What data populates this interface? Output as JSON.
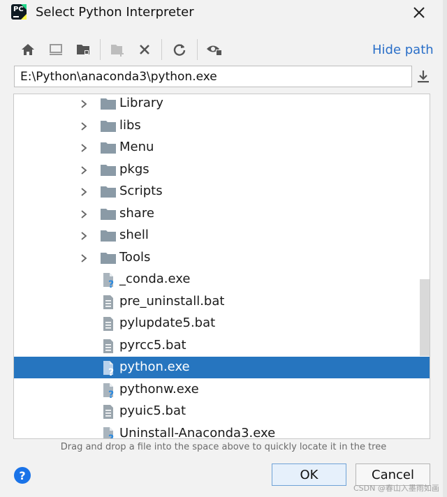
{
  "window": {
    "title": "Select Python Interpreter"
  },
  "toolbar": {
    "icons": [
      "home-icon",
      "desktop-icon",
      "project-folder-icon",
      "new-folder-icon",
      "delete-icon",
      "refresh-icon",
      "show-hidden-icon"
    ],
    "hide_path_label": "Hide path"
  },
  "path": {
    "value": "E:\\Python\\anaconda3\\python.exe"
  },
  "tree": {
    "items": [
      {
        "label": "Library",
        "kind": "folder"
      },
      {
        "label": "libs",
        "kind": "folder"
      },
      {
        "label": "Menu",
        "kind": "folder"
      },
      {
        "label": "pkgs",
        "kind": "folder"
      },
      {
        "label": "Scripts",
        "kind": "folder"
      },
      {
        "label": "share",
        "kind": "folder"
      },
      {
        "label": "shell",
        "kind": "folder"
      },
      {
        "label": "Tools",
        "kind": "folder"
      },
      {
        "label": "_conda.exe",
        "kind": "exe"
      },
      {
        "label": "pre_uninstall.bat",
        "kind": "text"
      },
      {
        "label": "pylupdate5.bat",
        "kind": "text"
      },
      {
        "label": "pyrcc5.bat",
        "kind": "text"
      },
      {
        "label": "python.exe",
        "kind": "exe",
        "selected": true
      },
      {
        "label": "pythonw.exe",
        "kind": "exe"
      },
      {
        "label": "pyuic5.bat",
        "kind": "text"
      },
      {
        "label": "Uninstall-Anaconda3.exe",
        "kind": "exe"
      }
    ]
  },
  "hint": "Drag and drop a file into the space above to quickly locate it in the tree",
  "footer": {
    "help_label": "?",
    "ok_label": "OK",
    "cancel_label": "Cancel",
    "watermark": "CSDN @春山入墨雨如画"
  },
  "colors": {
    "accent": "#2675bf",
    "link": "#2a6fc8",
    "folder": "#8a9aa6"
  }
}
